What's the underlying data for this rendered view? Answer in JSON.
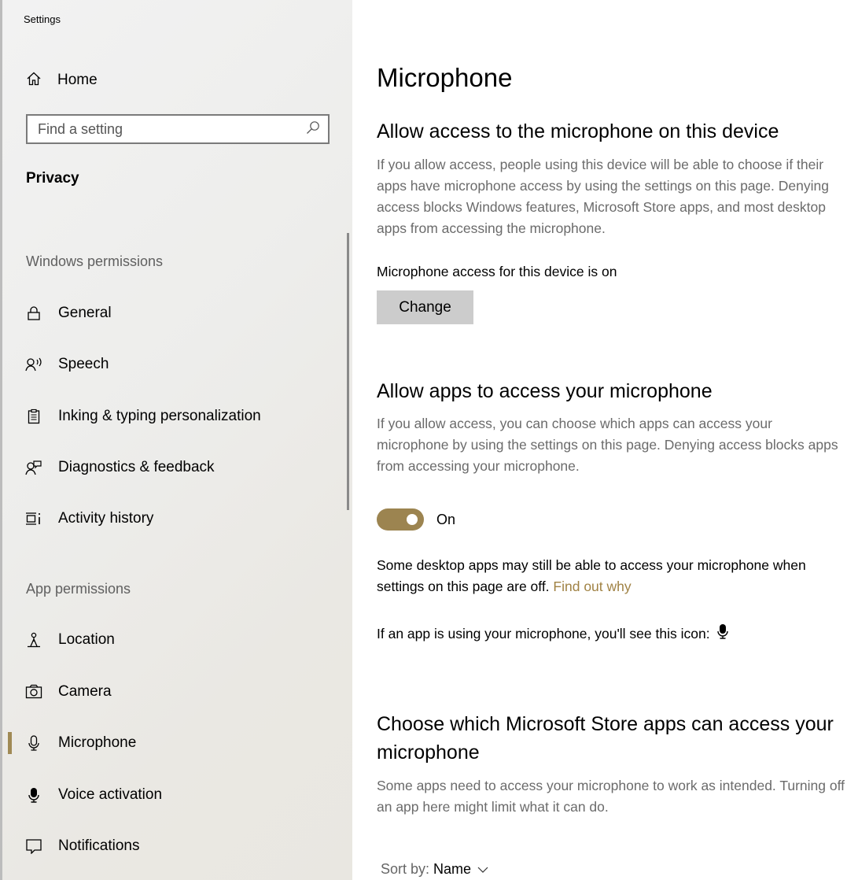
{
  "window": {
    "title": "Settings"
  },
  "sidebar": {
    "home_label": "Home",
    "search_placeholder": "Find a setting",
    "section_title": "Privacy",
    "groups": {
      "windows_permissions": "Windows permissions",
      "app_permissions": "App permissions"
    },
    "items": [
      {
        "label": "General",
        "icon": "lock-icon"
      },
      {
        "label": "Speech",
        "icon": "speech-icon"
      },
      {
        "label": "Inking & typing personalization",
        "icon": "clipboard-icon"
      },
      {
        "label": "Diagnostics & feedback",
        "icon": "feedback-icon"
      },
      {
        "label": "Activity history",
        "icon": "timeline-icon"
      },
      {
        "label": "Location",
        "icon": "location-icon"
      },
      {
        "label": "Camera",
        "icon": "camera-icon"
      },
      {
        "label": "Microphone",
        "icon": "microphone-icon",
        "selected": true
      },
      {
        "label": "Voice activation",
        "icon": "microphone-filled-icon"
      },
      {
        "label": "Notifications",
        "icon": "notification-icon"
      }
    ],
    "accent_color": "#a08a55"
  },
  "main": {
    "title": "Microphone",
    "device_access": {
      "heading": "Allow access to the microphone on this device",
      "description": "If you allow access, people using this device will be able to choose if their apps have microphone access by using the settings on this page. Denying access blocks Windows features, Microsoft Store apps, and most desktop apps from accessing the microphone.",
      "status": "Microphone access for this device is on",
      "change_button": "Change"
    },
    "apps_access": {
      "heading": "Allow apps to access your microphone",
      "description": "If you allow access, you can choose which apps can access your microphone by using the settings on this page. Denying access blocks apps from accessing your microphone.",
      "toggle_state": "On",
      "toggle_on": true,
      "note_text": "Some desktop apps may still be able to access your microphone when settings on this page are off.",
      "note_link": "Find out why",
      "icon_note": "If an app is using your microphone, you'll see this icon:"
    },
    "store_apps": {
      "heading": "Choose which Microsoft Store apps can access your microphone",
      "description": "Some apps need to access your microphone to work as intended. Turning off an app here might limit what it can do.",
      "sort_label": "Sort by:",
      "sort_value": "Name"
    },
    "accent_color": "#9c8450"
  }
}
